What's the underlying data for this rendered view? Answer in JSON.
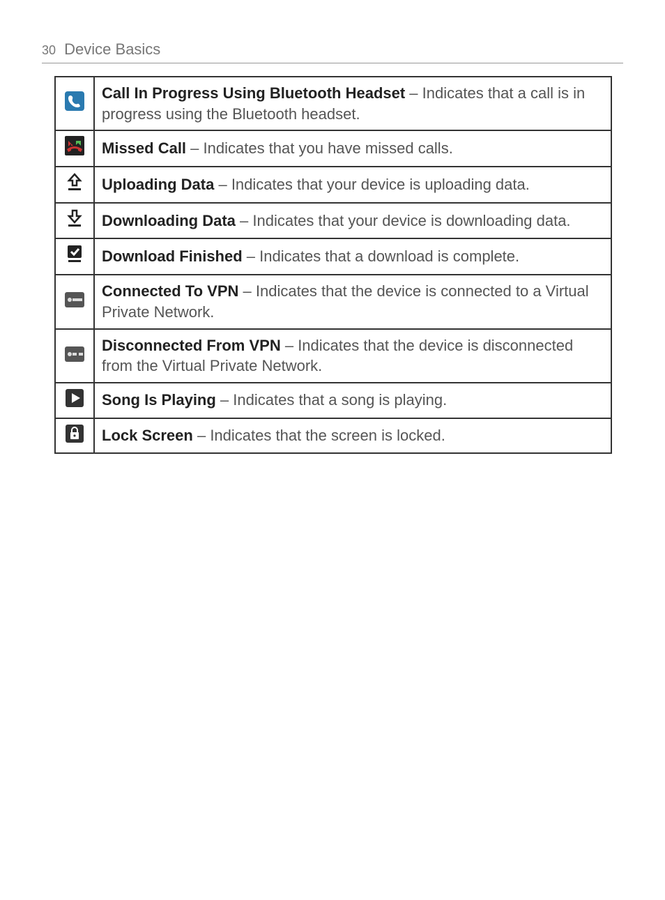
{
  "header": {
    "page_number": "30",
    "section_title": "Device Basics"
  },
  "rows": [
    {
      "icon": "bluetooth-call-icon",
      "title": "Call In Progress Using Bluetooth Headset",
      "desc": "Indicates that a call is in progress using the Bluetooth headset."
    },
    {
      "icon": "missed-call-icon",
      "title": "Missed Call",
      "desc": "Indicates that you have missed calls."
    },
    {
      "icon": "upload-icon",
      "title": "Uploading Data",
      "desc": "Indicates that your device is uploading data."
    },
    {
      "icon": "download-icon",
      "title": "Downloading Data",
      "desc": "Indicates that your device is downloading data."
    },
    {
      "icon": "download-complete-icon",
      "title": "Download Finished",
      "desc": "Indicates that a download is complete."
    },
    {
      "icon": "vpn-connected-icon",
      "title": "Connected To VPN",
      "desc": "Indicates that the device is connected to a Virtual Private Network."
    },
    {
      "icon": "vpn-disconnected-icon",
      "title": "Disconnected From VPN",
      "desc": "Indicates that the device is disconnected from the Virtual Private Network."
    },
    {
      "icon": "play-icon",
      "title": "Song Is Playing",
      "desc": "Indicates that a song is playing."
    },
    {
      "icon": "lock-icon",
      "title": "Lock Screen",
      "desc": "Indicates that the screen is locked."
    }
  ]
}
